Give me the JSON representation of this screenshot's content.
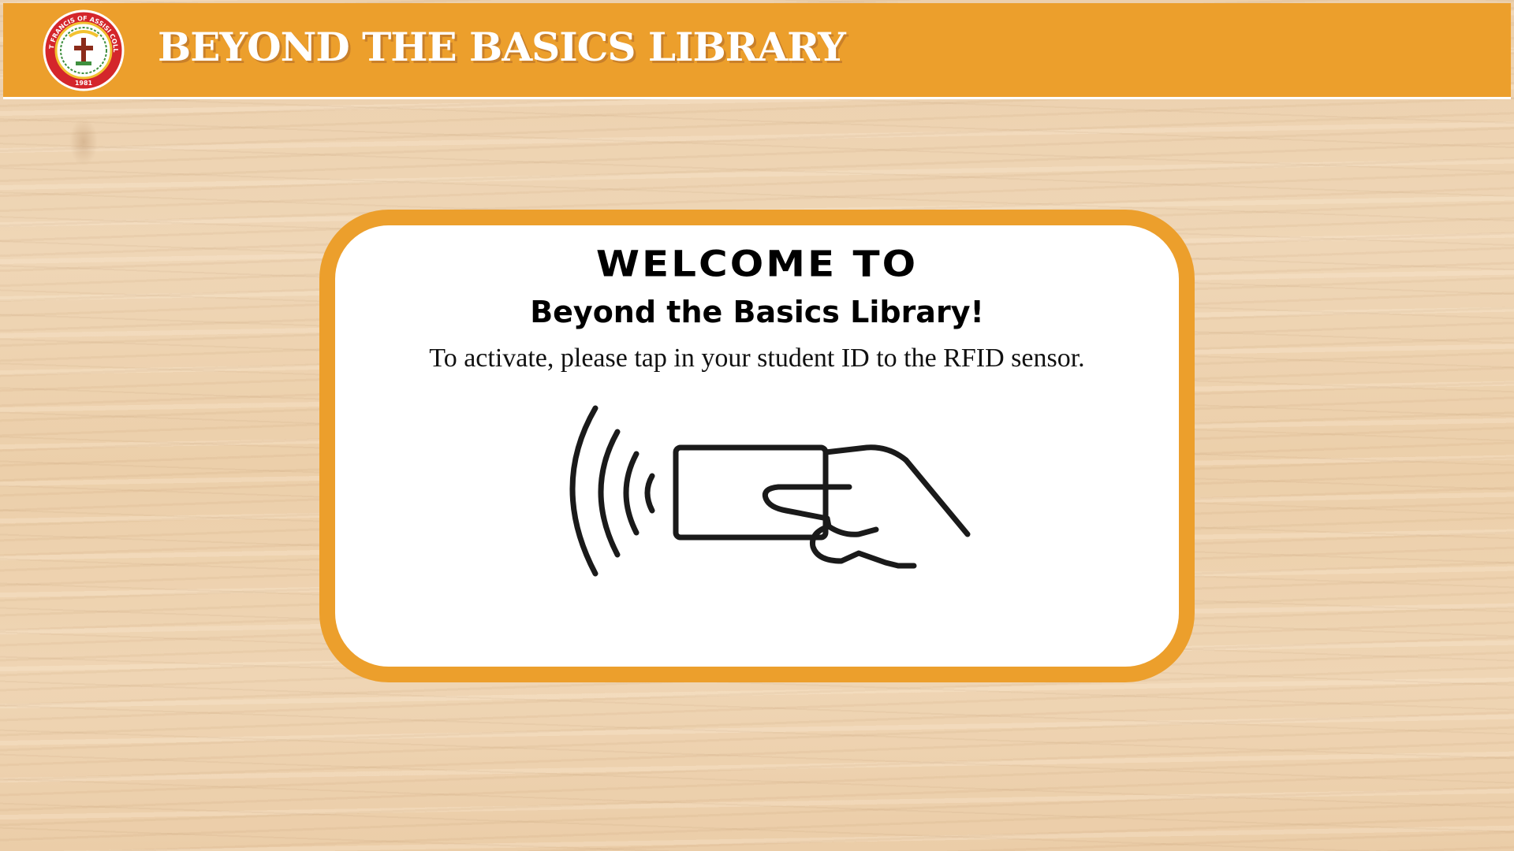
{
  "header": {
    "title": "BEYOND THE BASICS LIBRARY",
    "logo": {
      "icon": "college-seal-logo",
      "ring_text": "SAINT FRANCIS OF ASSISI COLLEGE",
      "year": "1981"
    }
  },
  "welcome": {
    "heading": "WELCOME TO",
    "subheading": "Beyond the Basics Library!",
    "instruction": "To activate, please tap in your student ID to the RFID sensor.",
    "illustration_icon": "rfid-tap-card-icon"
  },
  "colors": {
    "accent": "#ec9f2c",
    "seal_red": "#d4262b",
    "card_background": "#ffffff",
    "text": "#000000"
  }
}
